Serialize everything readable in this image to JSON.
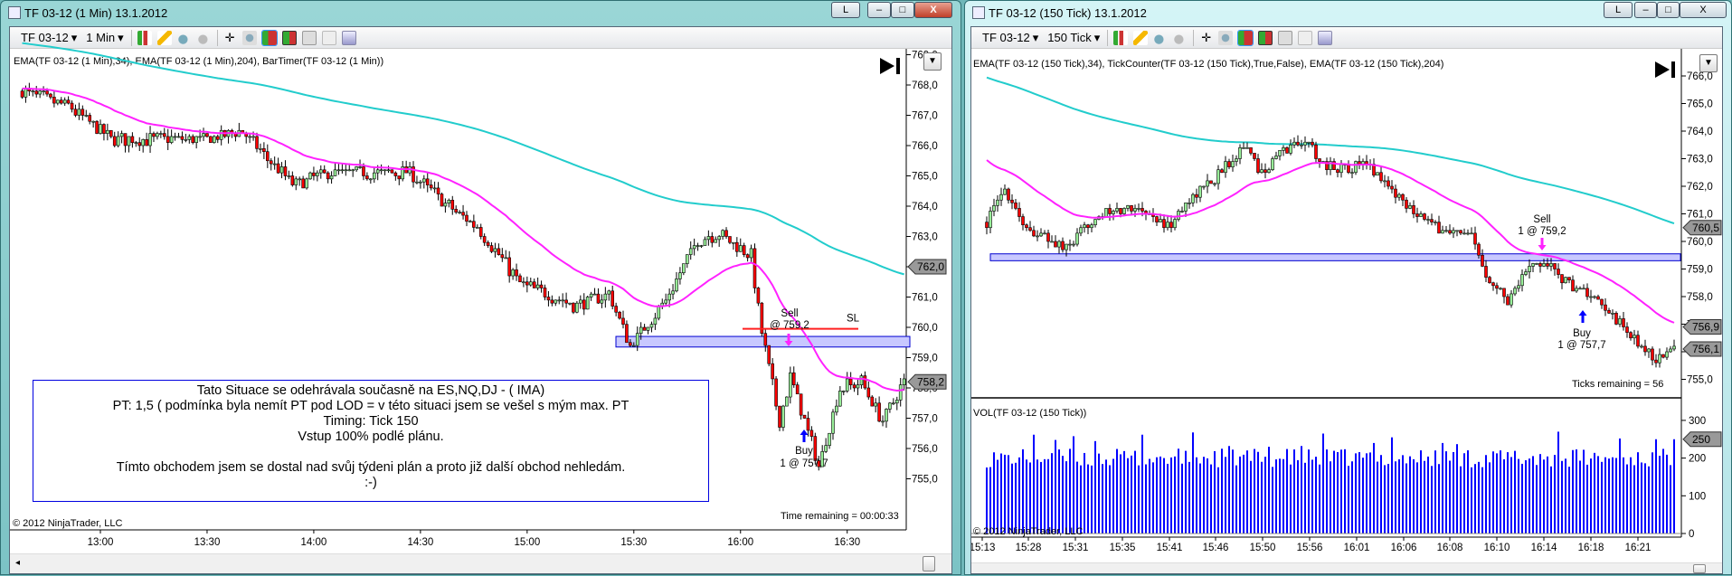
{
  "left": {
    "title": "TF 03-12 (1 Min)  13.1.2012",
    "buttons": {
      "l": "L",
      "min": "–",
      "max": "□",
      "close": "X"
    },
    "toolbar": {
      "instrument": "TF 03-12",
      "interval": "1 Min",
      "caret": "▾"
    },
    "legend": "EMA(TF 03-12 (1 Min),34), EMA(TF 03-12 (1 Min),204), BarTimer(TF 03-12 (1 Min))",
    "copyright": "© 2012 NinjaTrader, LLC",
    "timer": "Time remaining = 00:00:33",
    "note": [
      "Tato Situace se odehrávala současně na ES,NQ,DJ - ( IMA)",
      "PT: 1,5 ( podmínka byla nemít PT pod LOD = v této situaci jsem se vešel s mým max. PT",
      "Timing: Tick 150",
      "Vstup 100% podlé plánu.",
      "",
      "Tímto obchodem jsem se dostal nad svůj týdeni plán a proto již další obchod nehledám.",
      ":-)"
    ],
    "sell_label": [
      "Sell",
      "@ 759,2"
    ],
    "buy_label": [
      "Buy",
      "1 @ 757,7"
    ],
    "sl_label": "SL",
    "price_tags": [
      {
        "price": 762.0,
        "text": "762,0"
      },
      {
        "price": 758.2,
        "text": "758,2"
      }
    ]
  },
  "right": {
    "title": "TF 03-12 (150 Tick)  13.1.2012",
    "buttons": {
      "l": "L",
      "min": "–",
      "max": "□",
      "close": "X"
    },
    "toolbar": {
      "instrument": "TF 03-12",
      "interval": "150 Tick",
      "caret": "▾"
    },
    "legend": "EMA(TF 03-12 (150 Tick),34), TickCounter(TF 03-12 (150 Tick),True,False), EMA(TF 03-12 (150 Tick),204)",
    "vol_legend": "VOL(TF 03-12 (150 Tick))",
    "copyright": "© 2012 NinjaTrader, LLC",
    "ticks": "Ticks remaining = 56",
    "sell_label": [
      "Sell",
      "1 @ 759,2"
    ],
    "buy_label": [
      "Buy",
      "1 @ 757,7"
    ],
    "price_tags": [
      {
        "price": 760.5,
        "text": "760,5"
      },
      {
        "price": 756.9,
        "text": "756,9"
      },
      {
        "price": 756.1,
        "text": "756,1"
      }
    ],
    "vol_tag": {
      "value": 250,
      "text": "250"
    }
  },
  "chart_data": [
    {
      "type": "candlestick",
      "name": "TF 03-12 (1 Min)",
      "start_time": "12:38",
      "bars": 249,
      "yticks": [
        769,
        768,
        767,
        766,
        765,
        764,
        763,
        762,
        761,
        760,
        759,
        758,
        757,
        756,
        755
      ],
      "xticks": [
        "13:00",
        "13:30",
        "14:00",
        "14:30",
        "15:00",
        "15:30",
        "16:00",
        "16:30"
      ],
      "close_keypoints": [
        [
          "12:38",
          767.8
        ],
        [
          "12:51",
          767.3
        ],
        [
          "13:03",
          766.2
        ],
        [
          "13:12",
          766.2
        ],
        [
          "13:28",
          766.2
        ],
        [
          "13:40",
          766.45
        ],
        [
          "13:48",
          765.45
        ],
        [
          "13:54",
          764.7
        ],
        [
          "14:05",
          765.1
        ],
        [
          "14:27",
          765.1
        ],
        [
          "14:36",
          764.2
        ],
        [
          "14:46",
          763.3
        ],
        [
          "14:58",
          761.45
        ],
        [
          "15:14",
          760.7
        ],
        [
          "15:23",
          761.1
        ],
        [
          "15:29",
          759.4
        ],
        [
          "15:39",
          760.9
        ],
        [
          "15:48",
          762.9
        ],
        [
          "15:54",
          763.1
        ],
        [
          "16:03",
          762.35
        ],
        [
          "16:06",
          759.8
        ],
        [
          "16:11",
          756.9
        ],
        [
          "16:14",
          758.35
        ],
        [
          "16:19",
          756.55
        ],
        [
          "16:22",
          755.4
        ],
        [
          "16:28",
          758.0
        ],
        [
          "16:34",
          758.2
        ],
        [
          "16:40",
          756.9
        ],
        [
          "16:46",
          758.2
        ]
      ],
      "ema34_seed": 767.9,
      "ema204_seed": 769.4,
      "zone": [
        759.35,
        759.7
      ],
      "stop_loss": 759.95,
      "sell_price": 759.2,
      "buy_price": 757.7
    },
    {
      "type": "candlestick",
      "name": "TF 03-12 (150 Tick)",
      "bars": 191,
      "yticks": [
        766,
        765,
        764,
        763,
        762,
        761,
        760,
        759,
        758,
        757,
        756,
        755
      ],
      "xticks": [
        "15:13",
        "15:28",
        "15:31",
        "15:35",
        "15:41",
        "15:46",
        "15:50",
        "15:56",
        "16:01",
        "16:06",
        "16:08",
        "16:10",
        "16:14",
        "16:18",
        "16:21"
      ],
      "close_keypoints": [
        [
          0,
          760.7
        ],
        [
          5,
          761.9
        ],
        [
          11,
          760.5
        ],
        [
          22,
          759.7
        ],
        [
          30,
          760.9
        ],
        [
          36,
          761.1
        ],
        [
          42,
          761.3
        ],
        [
          50,
          760.5
        ],
        [
          57,
          761.7
        ],
        [
          63,
          762.3
        ],
        [
          71,
          763.5
        ],
        [
          76,
          762.5
        ],
        [
          82,
          763.3
        ],
        [
          88,
          763.7
        ],
        [
          94,
          762.7
        ],
        [
          106,
          762.7
        ],
        [
          115,
          761.5
        ],
        [
          124,
          760.5
        ],
        [
          134,
          760.1
        ],
        [
          138,
          758.9
        ],
        [
          144,
          757.9
        ],
        [
          150,
          759.1
        ],
        [
          155,
          759.2
        ],
        [
          160,
          758.5
        ],
        [
          166,
          758.1
        ],
        [
          167,
          757.9
        ],
        [
          173,
          757.3
        ],
        [
          180,
          756.3
        ],
        [
          185,
          755.7
        ],
        [
          190,
          756.1
        ]
      ],
      "ema34_seed": 763.1,
      "ema204_seed": 766.0,
      "zone": [
        759.3,
        759.55
      ],
      "sell_price": 759.2,
      "buy_price": 757.7,
      "volume": {
        "yticks": [
          0,
          100,
          200,
          300
        ],
        "base": [
          175,
          225
        ],
        "spikes": {
          "13": 262,
          "19": 248,
          "24": 258,
          "30": 245,
          "43": 262,
          "57": 268,
          "67": 232,
          "78": 230,
          "87": 232,
          "93": 265,
          "107": 240,
          "112": 255,
          "126": 240,
          "130": 237,
          "158": 270,
          "175": 252,
          "185": 250,
          "190": 250
        }
      }
    }
  ]
}
